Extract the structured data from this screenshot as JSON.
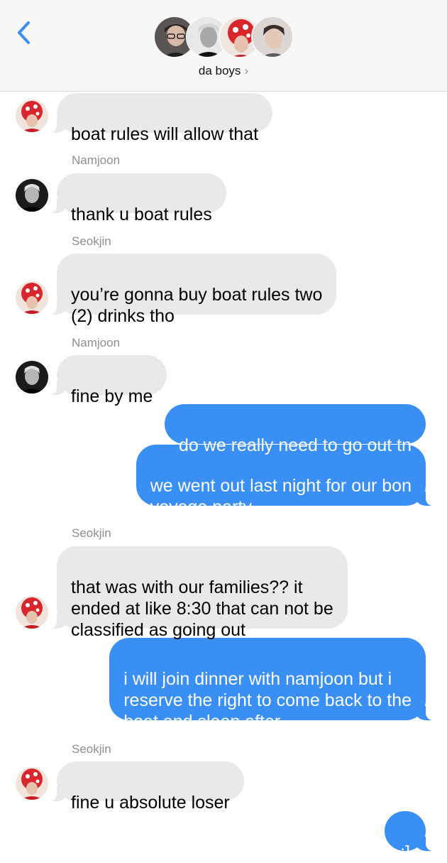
{
  "header": {
    "back_icon": "chevron-left-icon",
    "group_name": "da boys",
    "group_chevron": "›",
    "colors": {
      "accent": "#3a8ff5",
      "header_bg": "#f7f7f7"
    }
  },
  "messages": [
    {
      "direction": "in",
      "sender": "",
      "text": "boat rules will allow that",
      "avatar": "seokjin"
    },
    {
      "direction": "in",
      "sender": "Namjoon",
      "text": "thank u boat rules",
      "avatar": "namjoon"
    },
    {
      "direction": "in",
      "sender": "Seokjin",
      "text": "you’re gonna buy boat rules two\n(2) drinks tho",
      "avatar": "seokjin"
    },
    {
      "direction": "in",
      "sender": "Namjoon",
      "text": "fine by me",
      "avatar": "namjoon"
    },
    {
      "direction": "out",
      "text": "do we really need to go out tn"
    },
    {
      "direction": "out",
      "text": "we went out last night for our bon\nvoyage party"
    },
    {
      "direction": "in",
      "sender": "Seokjin",
      "text": "that was with our families?? it\nended at like 8:30 that can not be\nclassified as going out",
      "avatar": "seokjin"
    },
    {
      "direction": "out",
      "text": "i will join dinner with namjoon but i\nreserve the right to come back to the\nboat and sleep after"
    },
    {
      "direction": "in",
      "sender": "Seokjin",
      "text": "fine u absolute loser",
      "avatar": "seokjin"
    },
    {
      "direction": "out",
      "text": ":]"
    }
  ]
}
